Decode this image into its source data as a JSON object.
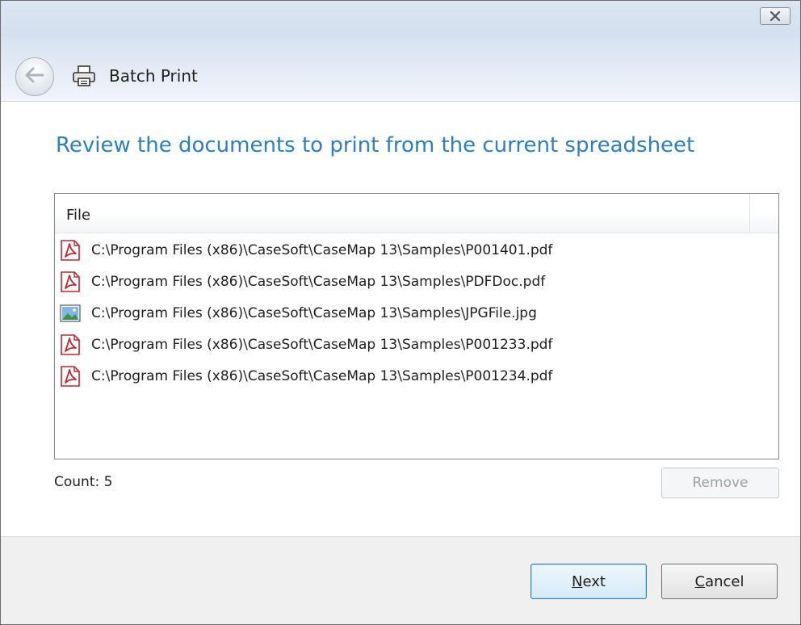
{
  "window": {
    "close_icon": "close-icon"
  },
  "nav": {
    "title": "Batch Print",
    "back_icon": "back-arrow-icon",
    "printer_icon": "printer-icon"
  },
  "heading": "Review the documents to print from the current spreadsheet",
  "file_list": {
    "column_header": "File",
    "files": [
      {
        "icon": "pdf-icon",
        "path": "C:\\Program Files (x86)\\CaseSoft\\CaseMap 13\\Samples\\P001401.pdf"
      },
      {
        "icon": "pdf-icon",
        "path": "C:\\Program Files (x86)\\CaseSoft\\CaseMap 13\\Samples\\PDFDoc.pdf"
      },
      {
        "icon": "image-icon",
        "path": "C:\\Program Files (x86)\\CaseSoft\\CaseMap 13\\Samples\\JPGFile.jpg"
      },
      {
        "icon": "pdf-icon",
        "path": "C:\\Program Files (x86)\\CaseSoft\\CaseMap 13\\Samples\\P001233.pdf"
      },
      {
        "icon": "pdf-icon",
        "path": "C:\\Program Files (x86)\\CaseSoft\\CaseMap 13\\Samples\\P001234.pdf"
      }
    ]
  },
  "count_label": "Count: 5",
  "buttons": {
    "remove": "Remove",
    "next_accel": "N",
    "next_rest": "ext",
    "cancel_accel": "C",
    "cancel_rest": "ancel"
  },
  "colors": {
    "heading": "#2b7fc2",
    "pdf_red": "#c1272d",
    "default_button_border": "#3c7fb1"
  }
}
